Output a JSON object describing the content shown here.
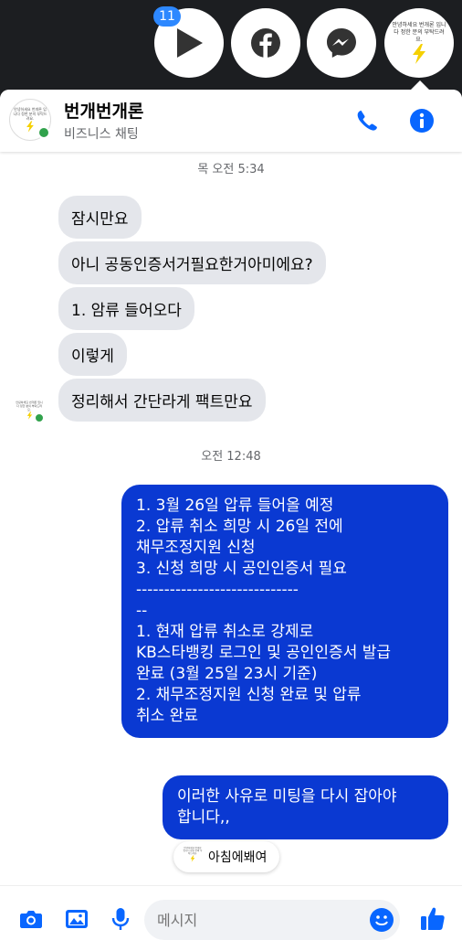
{
  "chat_heads": {
    "badge_count": "11",
    "logo_text": "안녕하세요 번개론 입니다 정한 분의 부탁드려요."
  },
  "header": {
    "name": "번개번개론",
    "subtitle": "비즈니스 채팅"
  },
  "messages": {
    "ts1": "목 오전 5:34",
    "in1": "잠시만요",
    "in2": "아니 공동인증서거필요한거아미에요?",
    "in3": "1. 암류 들어오다",
    "in4": "이렇게",
    "in5": "정리해서 간단라게 팩트만요",
    "ts2": "오전 12:48",
    "out1": "1. 3월 26일 압류 들어올 예정\n2. 압류 취소 희망 시 26일 전에\n채무조정지원 신청\n3. 신청 희망 시 공인인증서 필요\n-----------------------------\n--\n1. 현재 압류 취소로 강제로\nKB스타뱅킹 로그인 및 공인인증서 발급\n완료 (3월 25일 23시 기준)\n2. 채무조정지원 신청 완료 및 압류\n취소 완료",
    "out2": "이러한 사유로 미팅을 다시 잡아야\n합니다,,",
    "typing_name": "아침에봬여"
  },
  "composer": {
    "placeholder": "메시지"
  },
  "colors": {
    "accent": "#0866ff",
    "outgoing_bubble": "#0a39d2",
    "incoming_bubble": "#e4e6eb",
    "online": "#31a24c",
    "bolt": "#f5d000"
  }
}
